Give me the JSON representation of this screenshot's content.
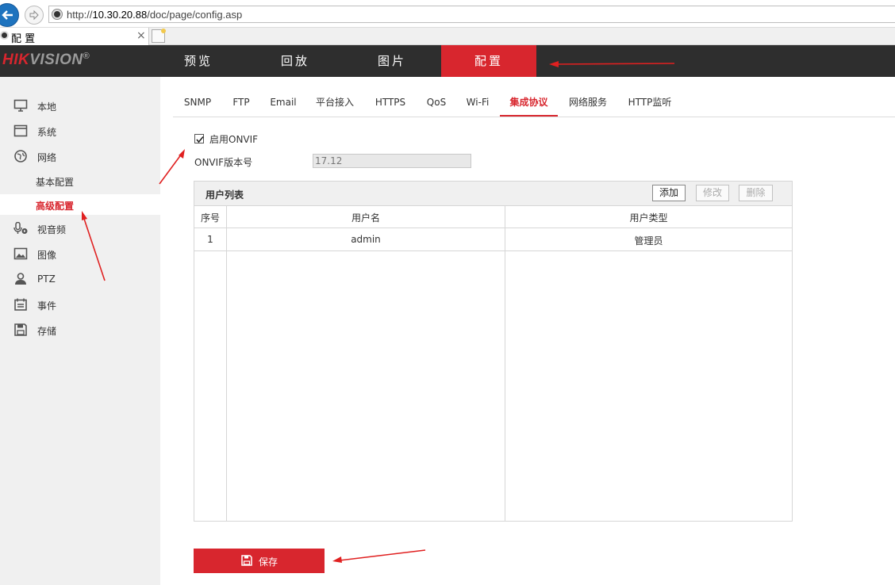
{
  "browser": {
    "url_prefix": "http://",
    "url_host": "10.30.20.88",
    "url_path": "/doc/page/config.asp",
    "tab_title": "配 置",
    "tab_close": "×"
  },
  "header": {
    "logo_red": "HIK",
    "logo_gray": "VISION",
    "logo_reg": "®",
    "nav": [
      "预览",
      "回放",
      "图片",
      "配置"
    ]
  },
  "sidebar": {
    "items": [
      {
        "label": "本地",
        "icon": "monitor-icon"
      },
      {
        "label": "系统",
        "icon": "window-icon"
      },
      {
        "label": "网络",
        "icon": "globe-icon"
      },
      {
        "label": "视音频",
        "icon": "microphone-icon"
      },
      {
        "label": "图像",
        "icon": "image-icon"
      },
      {
        "label": "PTZ",
        "icon": "person-icon"
      },
      {
        "label": "事件",
        "icon": "calendar-icon"
      },
      {
        "label": "存储",
        "icon": "floppy-icon"
      }
    ],
    "sub_items": [
      "基本配置",
      "高级配置"
    ]
  },
  "subtabs": [
    "SNMP",
    "FTP",
    "Email",
    "平台接入",
    "HTTPS",
    "QoS",
    "Wi-Fi",
    "集成协议",
    "网络服务",
    "HTTP监听"
  ],
  "form": {
    "enable_onvif_label": "启用ONVIF",
    "enable_onvif_checked": true,
    "version_label": "ONVIF版本号",
    "version_value": "17.12"
  },
  "user_list": {
    "title": "用户列表",
    "buttons": {
      "add": "添加",
      "modify": "修改",
      "delete": "删除"
    },
    "columns": [
      "序号",
      "用户名",
      "用户类型"
    ],
    "rows": [
      {
        "no": "1",
        "username": "admin",
        "type": "管理员"
      }
    ]
  },
  "save_label": "保存",
  "colors": {
    "accent": "#d8262e",
    "header_bg": "#2e2e2e",
    "sidebar_bg": "#f0f0f0"
  }
}
